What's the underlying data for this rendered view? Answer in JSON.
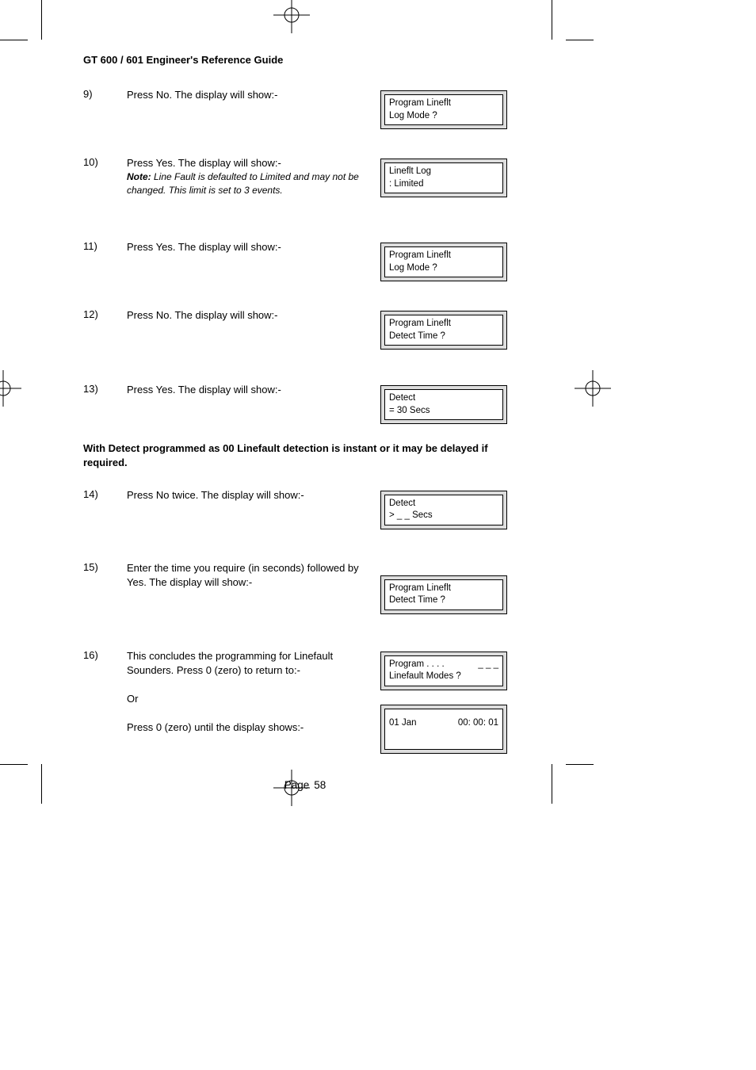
{
  "doc_title": "GT 600 / 601 Engineer's Reference Guide",
  "steps": {
    "s9": {
      "num": "9)",
      "text": "Press No. The display will show:-",
      "display": [
        "Program Lineflt",
        "Log Mode ?"
      ]
    },
    "s10": {
      "num": "10)",
      "text": "Press Yes. The display will show:-",
      "note_label": "Note:",
      "note_rest": " Line Fault is defaulted to Limited and may not be changed. This limit is set to 3 events.",
      "display": [
        "Lineflt Log",
        ": Limited"
      ]
    },
    "s11": {
      "num": "11)",
      "text": "Press Yes. The display will show:-",
      "display": [
        "Program Lineflt",
        "Log Mode ?"
      ]
    },
    "s12": {
      "num": "12)",
      "text": "Press No. The display will show:-",
      "display": [
        "Program Lineflt",
        "Detect Time ?"
      ]
    },
    "s13": {
      "num": "13)",
      "text": "Press Yes. The display will show:-",
      "display": [
        "Detect",
        "= 30 Secs"
      ]
    },
    "mid": "With Detect programmed as 00 Linefault detection is instant or it may be delayed if required.",
    "s14": {
      "num": "14)",
      "text": "Press No twice. The display will show:-",
      "display": [
        "Detect",
        "> _ _ Secs"
      ]
    },
    "s15": {
      "num": "15)",
      "text": "Enter the time you require (in seconds) followed by Yes. The display will show:-",
      "display": [
        "Program Lineflt",
        "Detect Time ?"
      ]
    },
    "s16": {
      "num": "16)",
      "text": "This concludes the programming for Linefault Sounders. Press 0 (zero) to return to:-",
      "or": "Or",
      "text2": "Press 0 (zero) until the display shows:-",
      "display_a_l1": "Program . . . .",
      "display_a_r1": "_ _ _",
      "display_a_l2": "Linefault Modes ?",
      "display_b_l": "01 Jan",
      "display_b_r": "00: 00: 01"
    }
  },
  "page_label": "Page",
  "page_number": "58"
}
